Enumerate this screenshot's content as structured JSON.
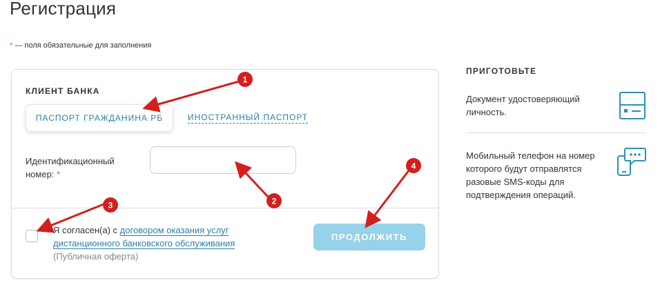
{
  "page": {
    "title": "Регистрация",
    "required_star": "*",
    "required_note": " — поля обязательные для заполнения"
  },
  "form": {
    "heading": "КЛИЕНТ БАНКА",
    "tabs": [
      {
        "label": "ПАСПОРТ ГРАЖДАНИНА РБ",
        "active": true
      },
      {
        "label": "ИНОСТРАННЫЙ ПАСПОРТ",
        "active": false
      }
    ],
    "id_field": {
      "label": "Идентификационный номер:",
      "required_star": "*",
      "value": "",
      "placeholder": ""
    },
    "agreement": {
      "prefix": "Я согласен(а) с ",
      "link": "договором оказания услуг дистанционного банковского обслуживания",
      "note": "(Публичная оферта)",
      "checked": false
    },
    "continue_label": "ПРОДОЛЖИТЬ"
  },
  "sidebar": {
    "title": "ПРИГОТОВЬТЕ",
    "items": [
      {
        "text": "Документ удостоверяющий личность.",
        "icon": "document-icon"
      },
      {
        "text": "Мобильный телефон на номер которого будут отправлятся разовые SMS-коды для подтверждения операций.",
        "icon": "mobile-sms-icon"
      }
    ]
  },
  "annotations": {
    "badges": [
      "1",
      "2",
      "3",
      "4"
    ],
    "color": "#d31f1f"
  },
  "colors": {
    "accent": "#2b7fa8",
    "button_disabled": "#96d2e9",
    "required": "#e8542e"
  }
}
